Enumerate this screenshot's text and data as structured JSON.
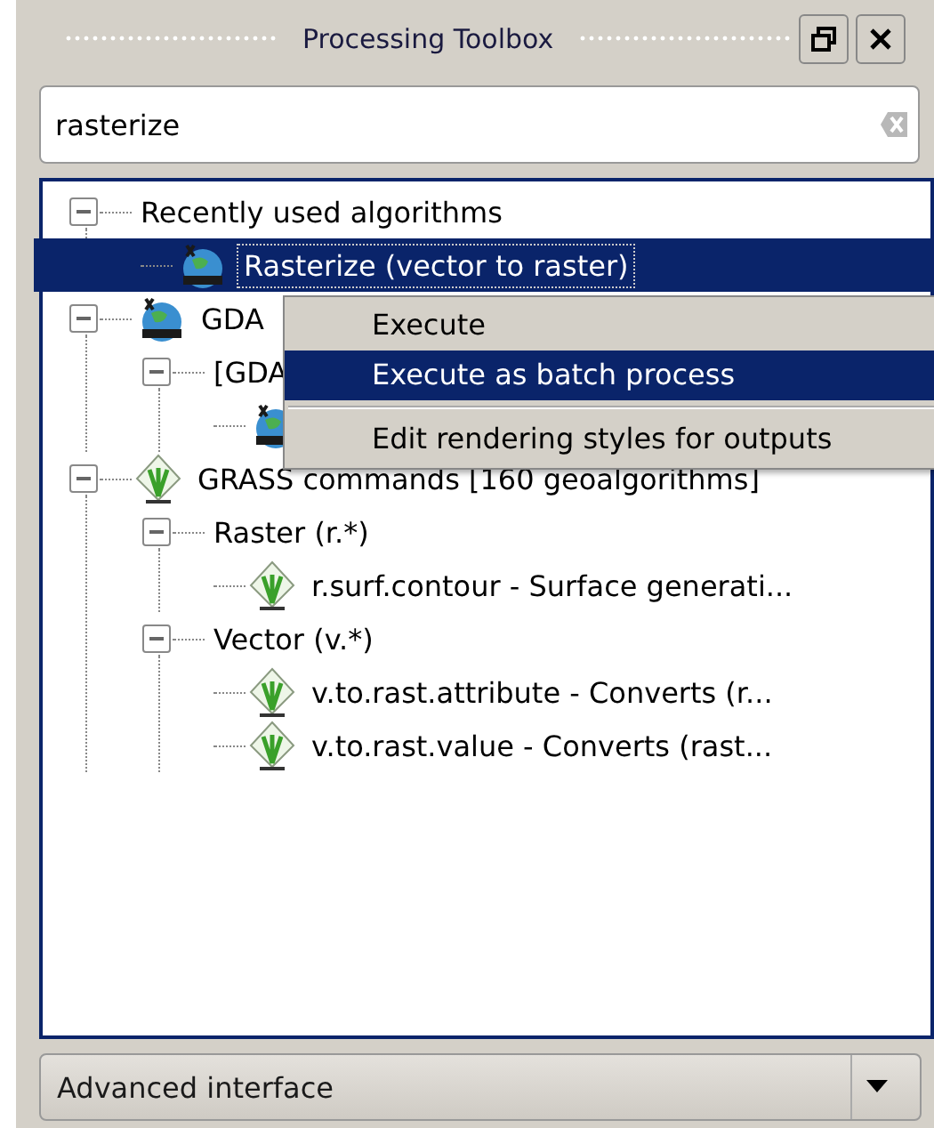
{
  "window": {
    "title": "Processing Toolbox"
  },
  "search": {
    "value": "rasterize"
  },
  "tree": [
    {
      "label": "Recently used algorithms",
      "expanded": true,
      "selected": false,
      "children": [
        {
          "label": "Rasterize (vector to raster)",
          "kind": "gdal",
          "selected": true
        }
      ]
    },
    {
      "label": "GDA",
      "kind": "gdal",
      "expanded": true,
      "selected": false,
      "children": [
        {
          "label": "[GDA",
          "expanded": true,
          "selected": false,
          "children": [
            {
              "kind": "gdal"
            }
          ]
        }
      ]
    },
    {
      "label": "GRASS commands [160 geoalgorithms]",
      "kind": "grass",
      "expanded": true,
      "selected": false,
      "children": [
        {
          "label": "Raster (r.*)",
          "expanded": true,
          "selected": false,
          "children": [
            {
              "label": "r.surf.contour - Surface generati...",
              "kind": "grass",
              "selected": false
            }
          ]
        },
        {
          "label": "Vector (v.*)",
          "expanded": true,
          "selected": false,
          "children": [
            {
              "label": "v.to.rast.attribute - Converts (r...",
              "kind": "grass",
              "selected": false
            },
            {
              "label": "v.to.rast.value - Converts (rast...",
              "kind": "grass",
              "selected": false
            }
          ]
        }
      ]
    }
  ],
  "context_menu": [
    {
      "label": "Execute",
      "selected": false
    },
    {
      "label": "Execute as batch process",
      "selected": true
    },
    {
      "kind": "separator"
    },
    {
      "label": "Edit rendering styles for outputs",
      "selected": false
    }
  ],
  "mode_combo": {
    "value": "Advanced interface"
  }
}
